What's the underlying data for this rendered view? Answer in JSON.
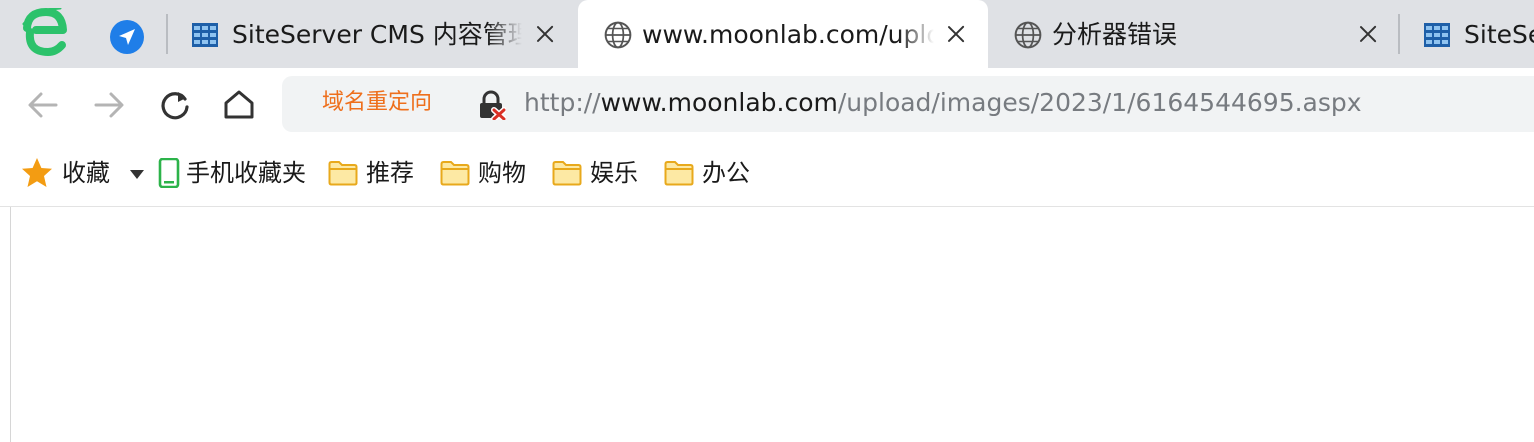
{
  "window": {
    "title": "www.moonlab.com/upload/images/2023/1/6164544695.aspx"
  },
  "brand": {
    "logo_icon": "browser-e-logo-icon",
    "logo_color": "#2cc26b",
    "send_color": "#1f7ee8"
  },
  "tabs": [
    {
      "label": "SiteServer CMS 内容管理系统",
      "icon": "siteserver-icon",
      "active": false
    },
    {
      "label": "www.moonlab.com/upload",
      "icon": "globe-icon",
      "active": true
    },
    {
      "label": "分析器错误",
      "icon": "globe-icon",
      "active": false
    },
    {
      "label": "SiteServer",
      "icon": "siteserver-icon",
      "active": false
    }
  ],
  "toolbar": {
    "back_icon": "arrow-left-icon",
    "forward_icon": "arrow-right-icon",
    "reload_icon": "reload-icon",
    "home_icon": "home-icon"
  },
  "address": {
    "redirect_label": "域名重定向",
    "redirect_color": "#ee6f1c",
    "security_icon": "insecure-lock-icon",
    "url_scheme": "http://",
    "url_host": "www.moonlab.com",
    "url_path": "/upload/images/2023/1/6164544695.aspx"
  },
  "bookmarks": {
    "favorites_label": "收藏",
    "mobile_label": "手机收藏夹",
    "folders": [
      "推荐",
      "购物",
      "娱乐",
      "办公"
    ]
  }
}
